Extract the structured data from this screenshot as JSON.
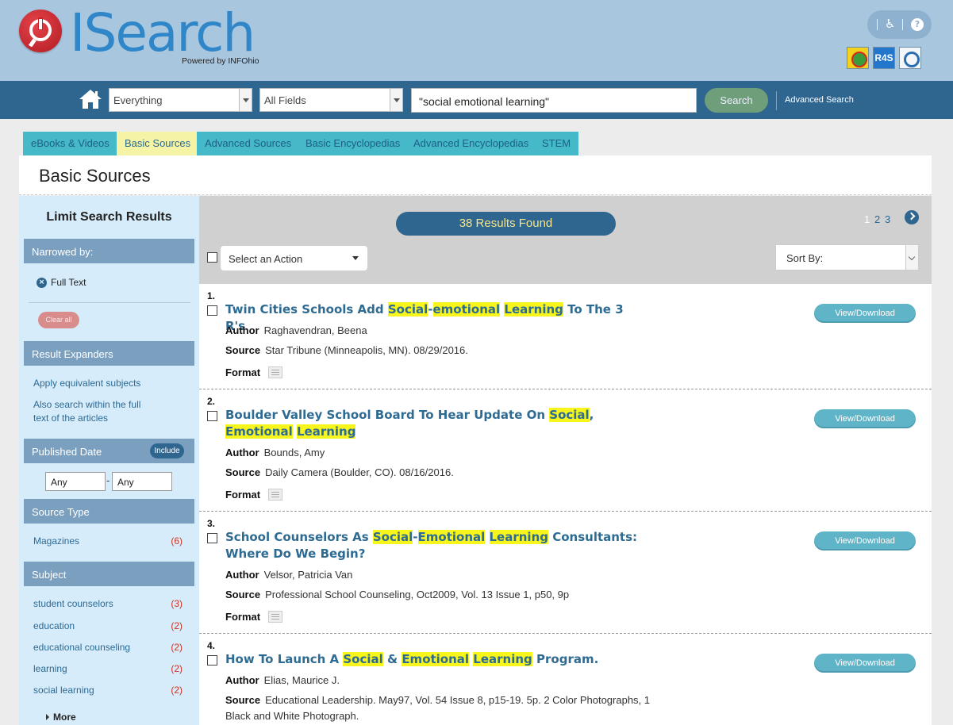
{
  "brand": {
    "name": "ISearch",
    "tagline": "Powered by INFOhio",
    "colors": {
      "primary": "#2f6690",
      "logo_blue": "#2f86c8",
      "logo_red": "#c8232a",
      "highlight": "#f7f51c"
    }
  },
  "utility": {
    "accessibility_icon": "wheelchair-icon",
    "help_icon": "help-icon",
    "help_symbol": "?",
    "badges": [
      "badge-app-1",
      "badge-r4s",
      "badge-power"
    ],
    "r4s_label": "R4S"
  },
  "search": {
    "scope_select": "Everything",
    "field_select": "All Fields",
    "query": "\"social emotional learning\"",
    "search_button": "Search",
    "advanced_link": "Advanced Search"
  },
  "tabs": [
    {
      "label": "eBooks & Videos",
      "active": false
    },
    {
      "label": "Basic Sources",
      "active": true
    },
    {
      "label": "Advanced Sources",
      "active": false
    },
    {
      "label": "Basic Encyclopedias",
      "active": false
    },
    {
      "label": "Advanced Encyclopedias",
      "active": false
    },
    {
      "label": "STEM",
      "active": false
    }
  ],
  "page_title": "Basic Sources",
  "sidebar": {
    "title": "Limit Search Results",
    "narrowed_by": {
      "heading": "Narrowed by:",
      "filters": [
        "Full Text"
      ],
      "clear_all": "Clear all"
    },
    "expanders": {
      "heading": "Result Expanders",
      "items": [
        "Apply equivalent subjects",
        "Also search within the full",
        "text of the articles"
      ]
    },
    "published_date": {
      "heading": "Published Date",
      "include": "Include",
      "from": "Any",
      "to": "Any",
      "separator": "-"
    },
    "source_type": {
      "heading": "Source Type",
      "items": [
        {
          "label": "Magazines",
          "count": "(6)"
        }
      ]
    },
    "subject": {
      "heading": "Subject",
      "items": [
        {
          "label": "student counselors",
          "count": "(3)"
        },
        {
          "label": "education",
          "count": "(2)"
        },
        {
          "label": "educational counseling",
          "count": "(2)"
        },
        {
          "label": "learning",
          "count": "(2)"
        },
        {
          "label": "social learning",
          "count": "(2)"
        }
      ],
      "more": "More"
    }
  },
  "results": {
    "count_text": "38 Results Found",
    "pages": [
      "1",
      "2",
      "3"
    ],
    "current_page": "1",
    "action_select": "Select an Action",
    "sort_label": "Sort By:",
    "labels": {
      "author": "Author",
      "source": "Source",
      "format": "Format",
      "view_download": "View/Download"
    },
    "items": [
      {
        "num": "1.",
        "title_parts": [
          {
            "text": "Twin Cities Schools Add ",
            "hl": false
          },
          {
            "text": "Social",
            "hl": true
          },
          {
            "text": "-",
            "hl": false
          },
          {
            "text": "emotional",
            "hl": true
          },
          {
            "text": " ",
            "hl": false
          },
          {
            "text": "Learning",
            "hl": true
          },
          {
            "text": " To The 3 R's",
            "hl": false
          }
        ],
        "author": "Raghavendran, Beena",
        "source": "Star Tribune (Minneapolis, MN). 08/29/2016.",
        "format_icon": "newspaper-icon"
      },
      {
        "num": "2.",
        "title_parts": [
          {
            "text": "Boulder Valley School Board To Hear Update On ",
            "hl": false
          },
          {
            "text": "Social",
            "hl": true
          },
          {
            "text": ", ",
            "hl": false
          },
          {
            "text": "Emotional",
            "hl": true
          },
          {
            "text": " ",
            "hl": false
          },
          {
            "text": "Learning",
            "hl": true
          }
        ],
        "author": "Bounds, Amy",
        "source": "Daily Camera (Boulder, CO). 08/16/2016.",
        "format_icon": "newspaper-icon"
      },
      {
        "num": "3.",
        "title_parts": [
          {
            "text": "School Counselors As ",
            "hl": false
          },
          {
            "text": "Social",
            "hl": true
          },
          {
            "text": "-",
            "hl": false
          },
          {
            "text": "Emotional",
            "hl": true
          },
          {
            "text": " ",
            "hl": false
          },
          {
            "text": "Learning",
            "hl": true
          },
          {
            "text": " Consultants: Where Do We Begin?",
            "hl": false
          }
        ],
        "author": "Velsor, Patricia Van",
        "source": "Professional School Counseling, Oct2009, Vol. 13 Issue 1, p50, 9p",
        "format_icon": "article-icon"
      },
      {
        "num": "4.",
        "title_parts": [
          {
            "text": "How To Launch A ",
            "hl": false
          },
          {
            "text": "Social",
            "hl": true
          },
          {
            "text": " & ",
            "hl": false
          },
          {
            "text": "Emotional",
            "hl": true
          },
          {
            "text": " ",
            "hl": false
          },
          {
            "text": "Learning",
            "hl": true
          },
          {
            "text": " Program.",
            "hl": false
          }
        ],
        "author": "Elias, Maurice J.",
        "source": "Educational Leadership. May97, Vol. 54 Issue 8, p15-19. 5p. 2 Color Photographs, 1 Black and White Photograph.",
        "format_icon": null
      }
    ]
  }
}
